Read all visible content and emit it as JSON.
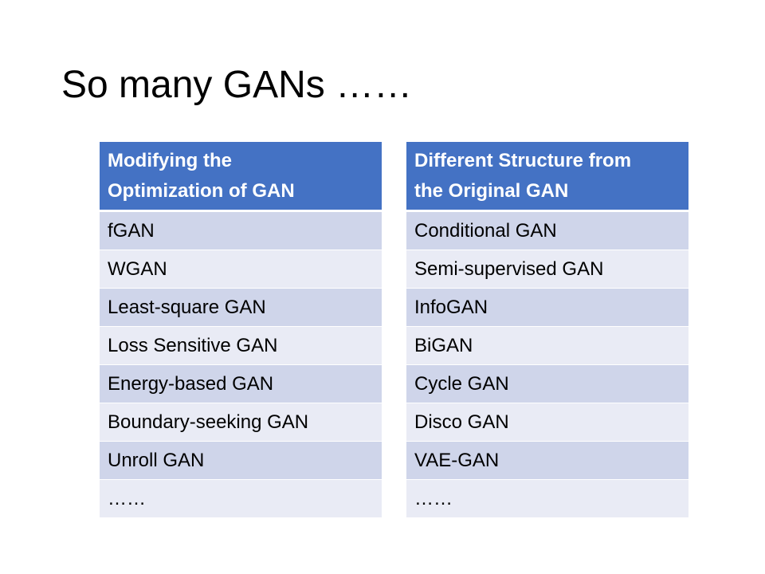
{
  "slide": {
    "title": "So many GANs ……"
  },
  "tables": {
    "left": {
      "header_line1": "Modifying the",
      "header_line2": "Optimization of GAN",
      "rows": [
        "fGAN",
        "WGAN",
        "Least-square GAN",
        "Loss Sensitive GAN",
        "Energy-based GAN",
        "Boundary-seeking GAN",
        "Unroll GAN",
        "……"
      ]
    },
    "right": {
      "header_line1": "Different Structure from",
      "header_line2": "the Original GAN",
      "rows": [
        "Conditional GAN",
        "Semi-supervised GAN",
        "InfoGAN",
        "BiGAN",
        "Cycle GAN",
        "Disco GAN",
        "VAE-GAN",
        "……"
      ]
    }
  },
  "colors": {
    "header_background": "#4472c4",
    "row_band_dark": "#cfd5ea",
    "row_band_light": "#e9ebf5"
  }
}
